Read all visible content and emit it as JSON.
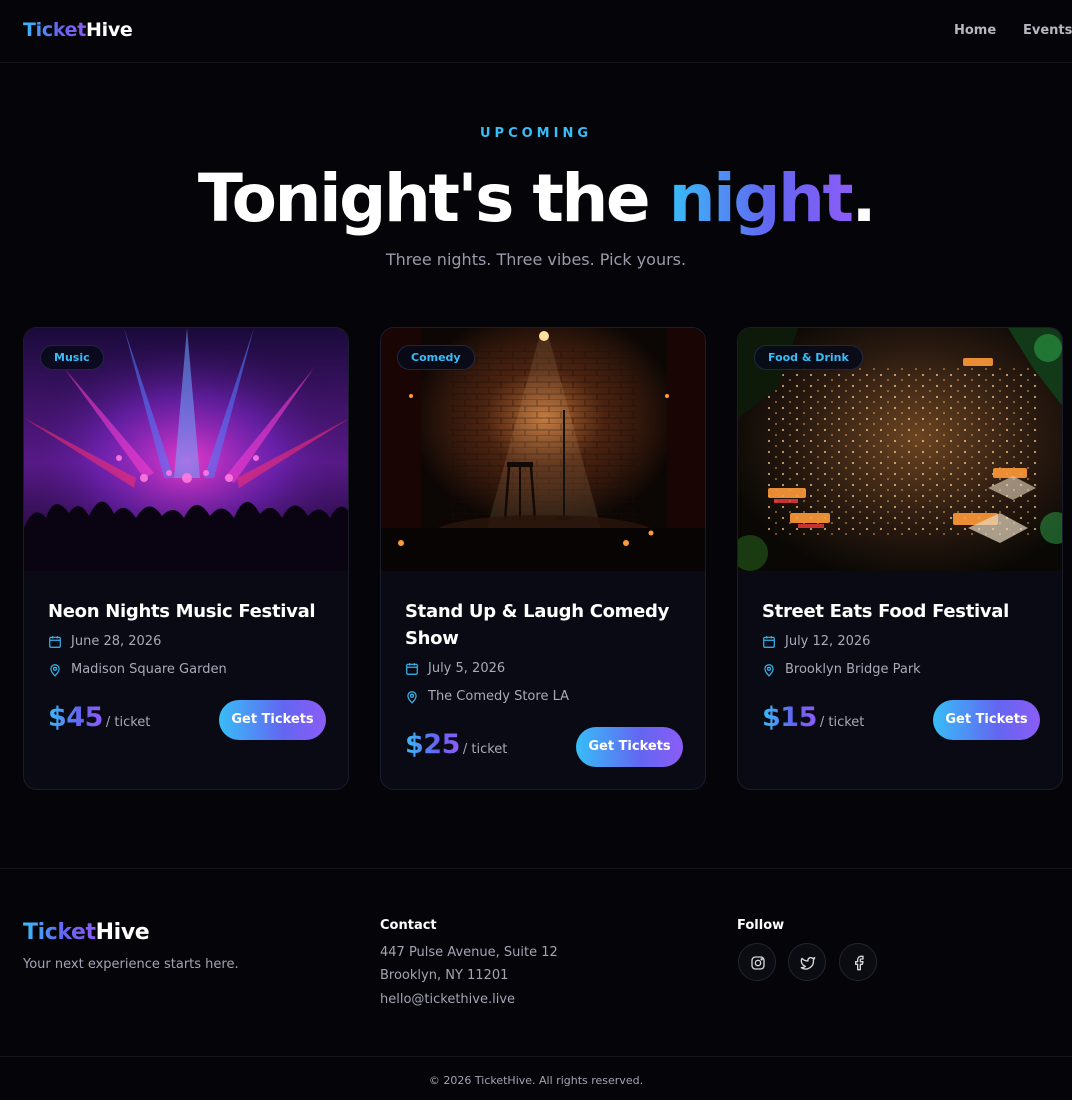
{
  "brand": {
    "part1": "Ticket",
    "part2": "Hive"
  },
  "nav": {
    "home": "Home",
    "events": "Events"
  },
  "hero": {
    "eyebrow": "UPCOMING",
    "title_start": "Tonight's the ",
    "title_accent": "night",
    "title_end": ".",
    "subtitle": "Three nights. Three vibes. Pick yours."
  },
  "events": [
    {
      "category": "Music",
      "title": "Neon Nights Music Festival",
      "date": "June 28, 2026",
      "venue": "Madison Square Garden",
      "price": "$45",
      "per": "/ ticket",
      "cta": "Get Tickets"
    },
    {
      "category": "Comedy",
      "title": "Stand Up & Laugh Comedy Show",
      "date": "July 5, 2026",
      "venue": "The Comedy Store LA",
      "price": "$25",
      "per": "/ ticket",
      "cta": "Get Tickets"
    },
    {
      "category": "Food & Drink",
      "title": "Street Eats Food Festival",
      "date": "July 12, 2026",
      "venue": "Brooklyn Bridge Park",
      "price": "$15",
      "per": "/ ticket",
      "cta": "Get Tickets"
    }
  ],
  "footer": {
    "tagline": "Your next experience starts here.",
    "contact_heading": "Contact",
    "address_line1": "447 Pulse Avenue, Suite 12",
    "address_line2": "Brooklyn, NY 11201",
    "email": "hello@tickethive.live",
    "follow_heading": "Follow",
    "social": [
      "instagram-icon",
      "twitter-icon",
      "facebook-icon"
    ],
    "copyright": "© 2026 TicketHive. All rights reserved."
  },
  "colors": {
    "background": "#050509",
    "accent_cyan": "#38bdf8",
    "accent_indigo": "#6366f1",
    "accent_violet": "#8b5cf6",
    "card": "#090a14"
  }
}
